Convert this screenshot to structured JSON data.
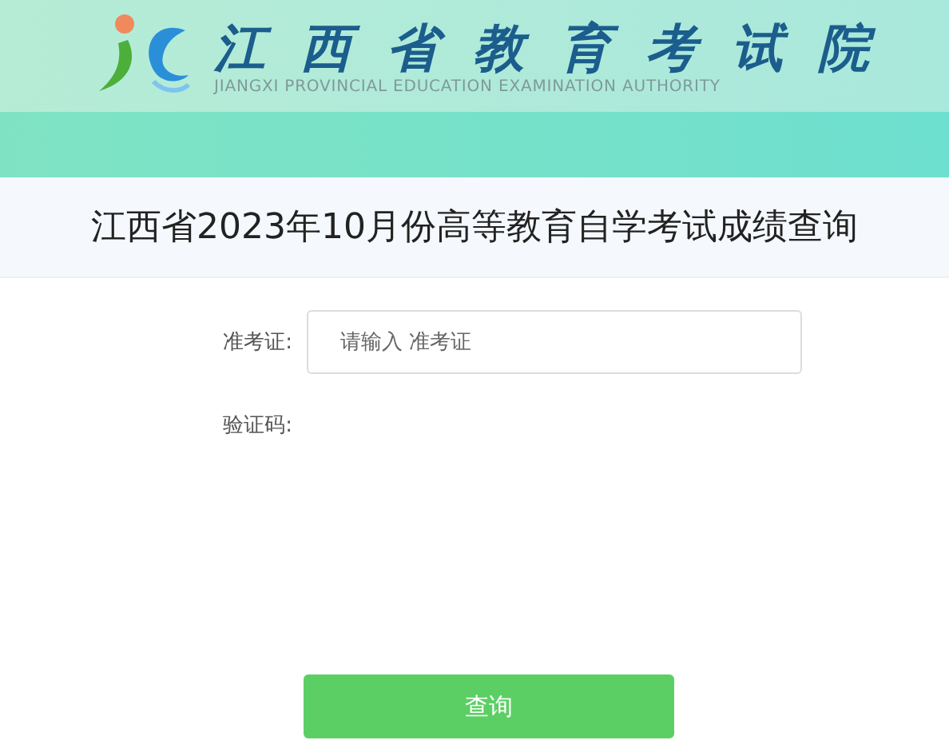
{
  "header": {
    "org_name": "江西省教育考试院",
    "org_name_en": "JIANGXI PROVINCIAL EDUCATION EXAMINATION AUTHORITY"
  },
  "title": "江西省2023年10月份高等教育自学考试成绩查询",
  "form": {
    "fields": [
      {
        "kind": "input",
        "label": "准考证:",
        "placeholder": "请输入 准考证"
      },
      {
        "kind": "captcha",
        "label": "验证码:"
      }
    ],
    "submit": "查询"
  }
}
